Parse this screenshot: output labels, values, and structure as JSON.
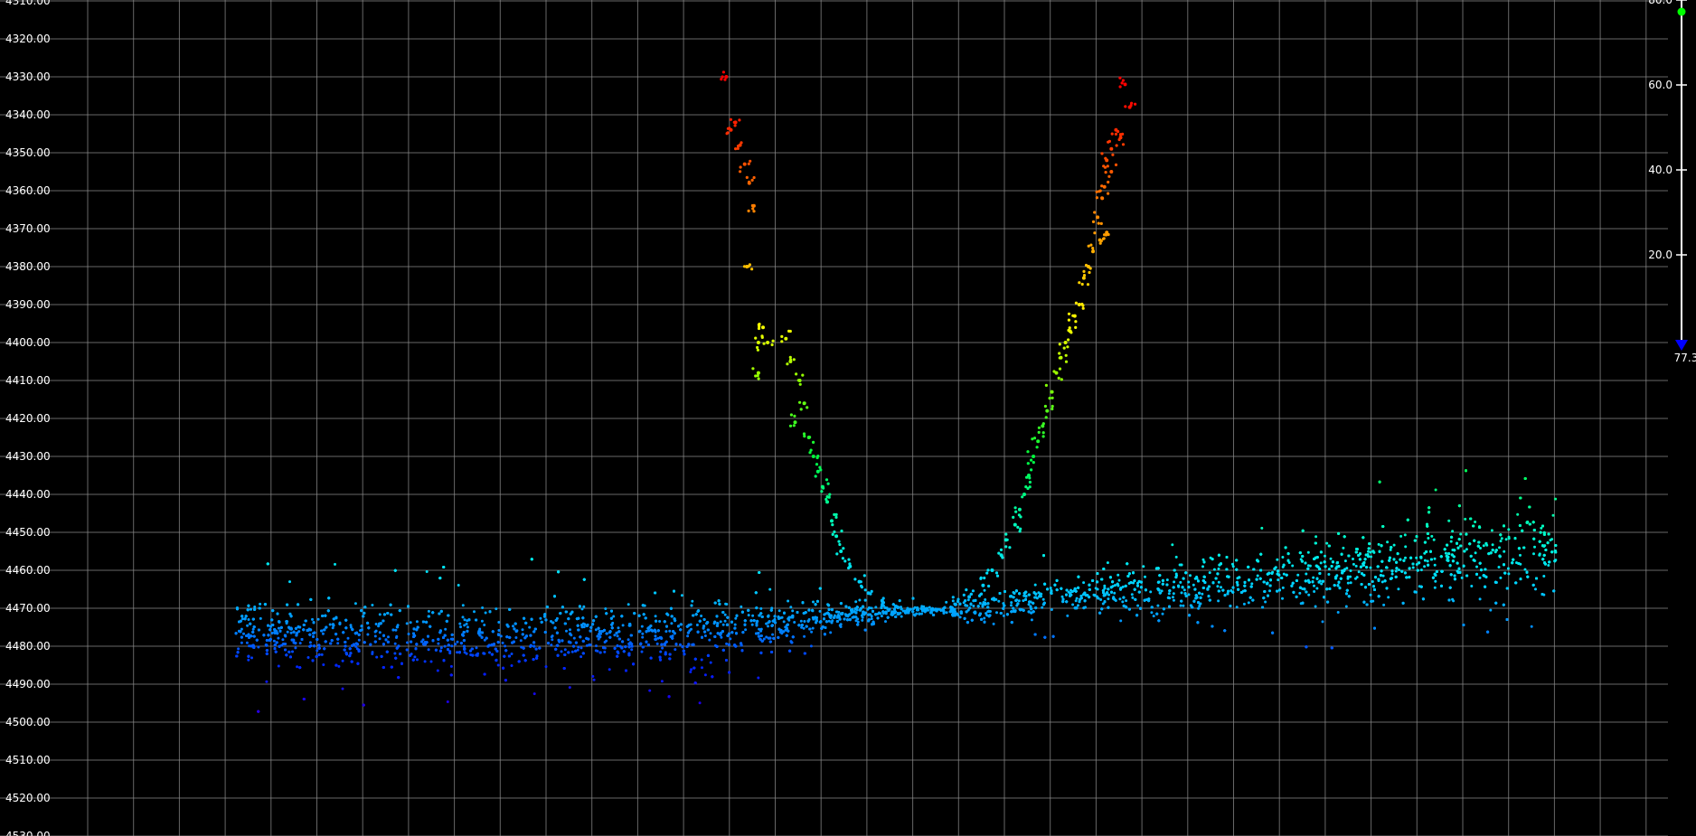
{
  "chart_data": {
    "type": "scatter",
    "title": "",
    "xlabel": "",
    "ylabel": "",
    "y_axis": {
      "reversed": true,
      "ylim": [
        4316,
        4530
      ],
      "ticks": [
        "4310.00",
        "4320.00",
        "4330.00",
        "4340.00",
        "4350.00",
        "4360.00",
        "4370.00",
        "4380.00",
        "4390.00",
        "4400.00",
        "4410.00",
        "4420.00",
        "4430.00",
        "4440.00",
        "4450.00",
        "4460.00",
        "4470.00",
        "4480.00",
        "4490.00",
        "4500.00",
        "4510.00",
        "4520.00",
        "4530.00"
      ],
      "tick_values": [
        4310,
        4320,
        4330,
        4340,
        4350,
        4360,
        4370,
        4380,
        4390,
        4400,
        4410,
        4420,
        4430,
        4440,
        4450,
        4460,
        4470,
        4480,
        4490,
        4500,
        4510,
        4520,
        4530
      ]
    },
    "x_axis": {
      "labels_shown": false,
      "grid_columns": 36
    },
    "grid": true,
    "background_color": "#000000",
    "grid_color": "#8a8a8a",
    "color_scale": {
      "position": "right",
      "ticks": [
        "80.0",
        "60.0",
        "40.0",
        "20.0"
      ],
      "tick_values": [
        80,
        60,
        40,
        20
      ],
      "min_label": "77.3",
      "colors": [
        "#6a00a8",
        "#0010ff",
        "#00a0ff",
        "#00ffe0",
        "#00ff40",
        "#ffff00",
        "#ff8000",
        "#ff0000"
      ],
      "top_handle_color": "#00ff00",
      "bottom_handle_color": "#0000ff"
    },
    "series": [
      {
        "description_points": "approximate trace of the dense band center (x in column units 0-36, y in data units)",
        "band_center": [
          [
            4.2,
            4477
          ],
          [
            8,
            4478
          ],
          [
            12,
            4477
          ],
          [
            14.5,
            4476
          ],
          [
            16,
            4474
          ],
          [
            17.5,
            4472
          ],
          [
            18.8,
            4470.5
          ],
          [
            20,
            4470.5
          ],
          [
            21.5,
            4468
          ],
          [
            23,
            4466
          ],
          [
            25,
            4465
          ],
          [
            27,
            4462
          ],
          [
            29,
            4460
          ],
          [
            31,
            4457
          ],
          [
            33,
            4454
          ]
        ]
      },
      {
        "name_hidden": "left arm",
        "points": [
          [
            14.9,
            4330
          ],
          [
            15,
            4344
          ],
          [
            15.1,
            4342
          ],
          [
            15.2,
            4348
          ],
          [
            15.3,
            4353
          ],
          [
            15.4,
            4358
          ],
          [
            15.5,
            4364
          ],
          [
            15.35,
            4380
          ],
          [
            15.7,
            4396
          ],
          [
            15.8,
            4400
          ],
          [
            15.6,
            4400
          ],
          [
            15.6,
            4408
          ],
          [
            16.2,
            4399
          ],
          [
            16.3,
            4405
          ],
          [
            16.5,
            4410
          ],
          [
            16.6,
            4416
          ],
          [
            16.4,
            4421
          ],
          [
            16.7,
            4425
          ],
          [
            16.8,
            4430
          ],
          [
            16.9,
            4434
          ],
          [
            17,
            4438
          ],
          [
            17.1,
            4442
          ],
          [
            17.2,
            4447
          ],
          [
            17.3,
            4451
          ],
          [
            17.4,
            4455
          ],
          [
            17.6,
            4459
          ],
          [
            17.8,
            4463
          ],
          [
            18,
            4466
          ],
          [
            18.3,
            4468
          ],
          [
            18.6,
            4469.5
          ]
        ]
      },
      {
        "name_hidden": "right arm",
        "points": [
          [
            23.6,
            4332
          ],
          [
            23.7,
            4338
          ],
          [
            23.4,
            4344
          ],
          [
            23.5,
            4346
          ],
          [
            23.3,
            4349
          ],
          [
            23.2,
            4352
          ],
          [
            23.3,
            4355
          ],
          [
            23.15,
            4359
          ],
          [
            23.1,
            4362
          ],
          [
            23.0,
            4367
          ],
          [
            23.2,
            4371
          ],
          [
            23.05,
            4373
          ],
          [
            22.9,
            4376
          ],
          [
            22.8,
            4380
          ],
          [
            22.7,
            4383
          ],
          [
            22.6,
            4390
          ],
          [
            22.5,
            4393
          ],
          [
            22.4,
            4397
          ],
          [
            22.3,
            4400
          ],
          [
            22.2,
            4404
          ],
          [
            22.1,
            4408
          ],
          [
            22.0,
            4413
          ],
          [
            21.9,
            4418
          ],
          [
            21.8,
            4422
          ],
          [
            21.7,
            4426
          ],
          [
            21.6,
            4430
          ],
          [
            21.5,
            4435
          ],
          [
            21.4,
            4440
          ],
          [
            21.3,
            4444
          ],
          [
            21.2,
            4448
          ],
          [
            21.0,
            4452
          ],
          [
            20.9,
            4456
          ],
          [
            20.7,
            4460
          ],
          [
            20.5,
            4464
          ],
          [
            20.2,
            4467
          ],
          [
            19.9,
            4469
          ]
        ]
      }
    ]
  }
}
